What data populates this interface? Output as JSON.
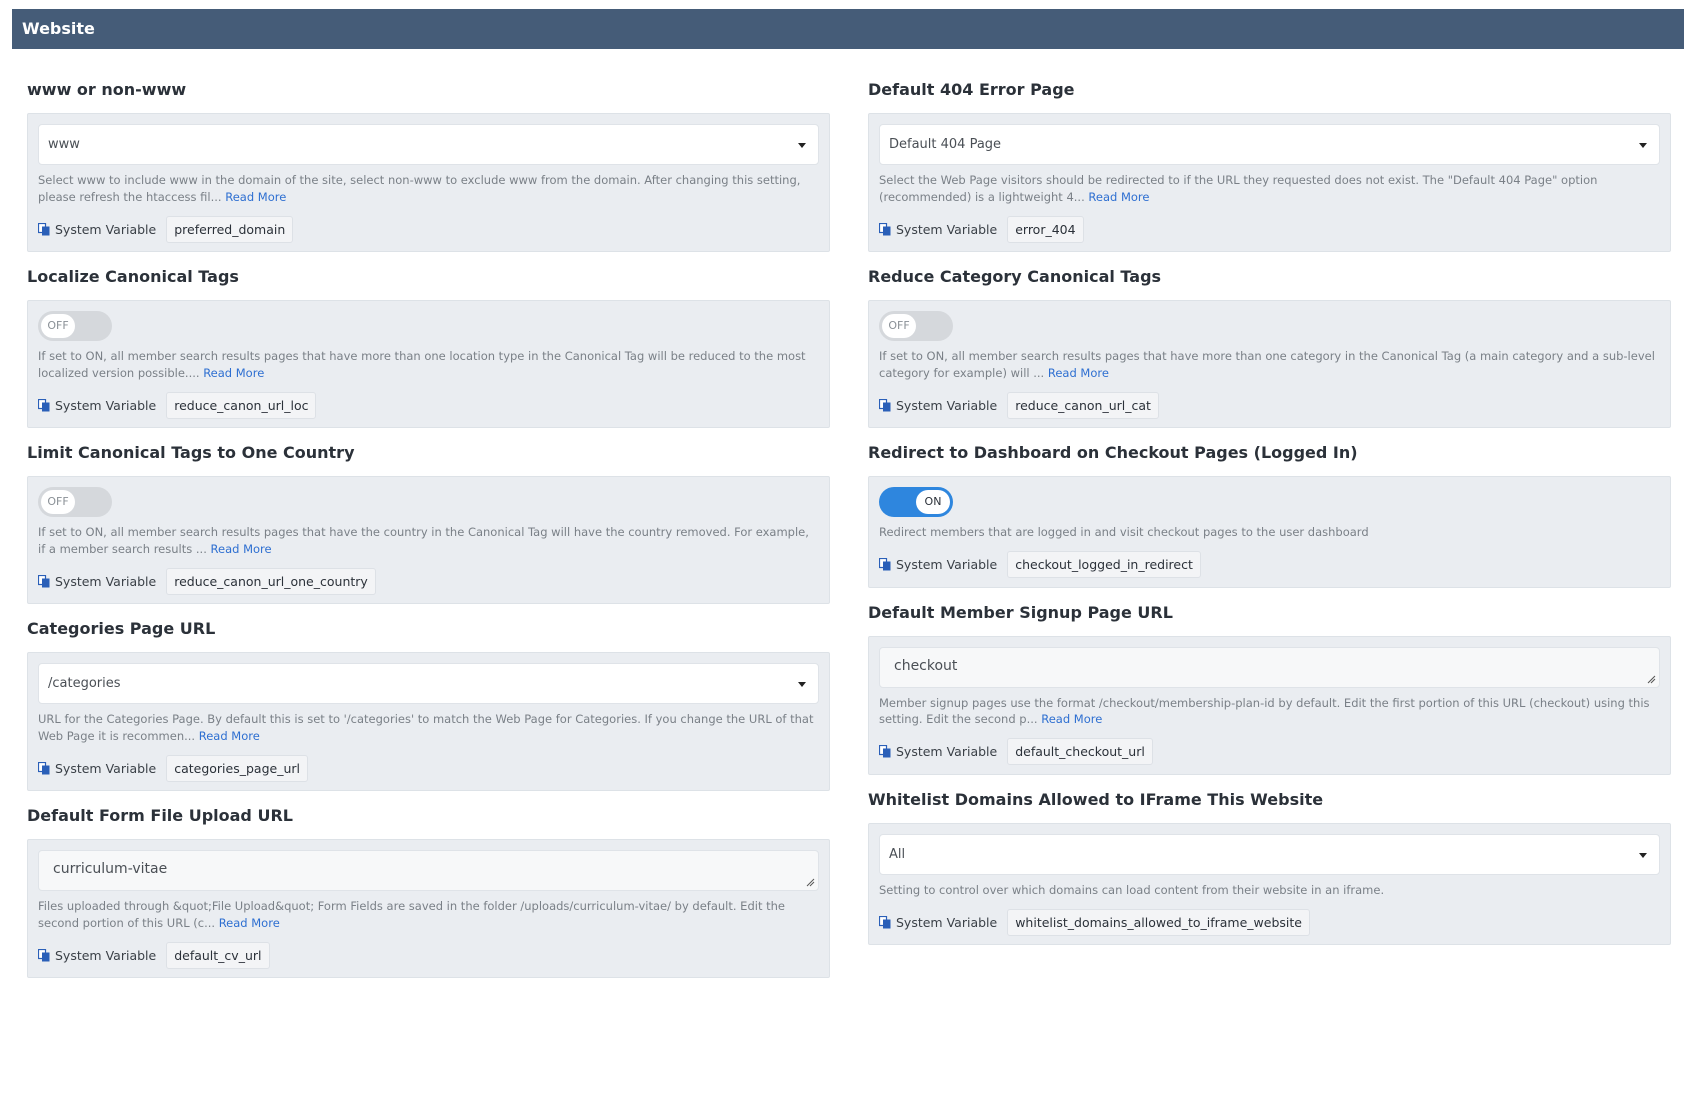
{
  "header": {
    "title": "Website"
  },
  "system_variable_label": "System Variable",
  "read_more": "Read More",
  "left": [
    {
      "title": "www or non-www",
      "control": {
        "type": "select",
        "value": "www"
      },
      "description": "Select www to include www in the domain of the site, select non-www to exclude www from the domain. After changing this setting, please refresh the htaccess fil...",
      "variable": "preferred_domain"
    },
    {
      "title": "Localize Canonical Tags",
      "control": {
        "type": "toggle",
        "value": "OFF"
      },
      "description": "If set to ON, all member search results pages that have more than one location type in the Canonical Tag will be reduced to the most localized version possible....",
      "variable": "reduce_canon_url_loc"
    },
    {
      "title": "Limit Canonical Tags to One Country",
      "control": {
        "type": "toggle",
        "value": "OFF"
      },
      "description": "If set to ON, all member search results pages that have the country in the Canonical Tag will have the country removed. For example, if a member search results ...",
      "variable": "reduce_canon_url_one_country"
    },
    {
      "title": "Categories Page URL",
      "control": {
        "type": "select",
        "value": "/categories"
      },
      "description": "URL for the Categories Page. By default this is set to '/categories' to match the Web Page for Categories. If you change the URL of that Web Page it is recommen...",
      "variable": "categories_page_url"
    },
    {
      "title": "Default Form File Upload URL",
      "control": {
        "type": "text",
        "value": "curriculum-vitae"
      },
      "description": "Files uploaded through &quot;File Upload&quot; Form Fields are saved in the folder /uploads/curriculum-vitae/ by default. Edit the second portion of this URL (c...",
      "variable": "default_cv_url"
    }
  ],
  "right": [
    {
      "title": "Default 404 Error Page",
      "control": {
        "type": "select",
        "value": "Default 404 Page"
      },
      "description": "Select the Web Page visitors should be redirected to if the URL they requested does not exist.  The \"Default 404 Page\" option (recommended) is a lightweight 4...",
      "variable": "error_404"
    },
    {
      "title": "Reduce Category Canonical Tags",
      "control": {
        "type": "toggle",
        "value": "OFF"
      },
      "description": "If set to ON, all member search results pages that have more than one category in the Canonical Tag (a main category and a sub-level category for example) will ...",
      "variable": "reduce_canon_url_cat"
    },
    {
      "title": "Redirect to Dashboard on Checkout Pages (Logged In)",
      "control": {
        "type": "toggle",
        "value": "ON"
      },
      "description": "Redirect members that are logged in and visit checkout pages to the user dashboard",
      "variable": "checkout_logged_in_redirect",
      "no_read_more": true
    },
    {
      "title": "Default Member Signup Page URL",
      "control": {
        "type": "text",
        "value": "checkout"
      },
      "description": "Member signup pages use the format /checkout/membership-plan-id by default. Edit the first portion of this URL (checkout) using this setting.  Edit the second p...",
      "variable": "default_checkout_url"
    },
    {
      "title": "Whitelist Domains Allowed to IFrame This Website",
      "control": {
        "type": "select",
        "value": "All"
      },
      "description": "Setting to control over which domains can load content from their website in an iframe.",
      "variable": "whitelist_domains_allowed_to_iframe_website",
      "no_read_more": true
    }
  ]
}
